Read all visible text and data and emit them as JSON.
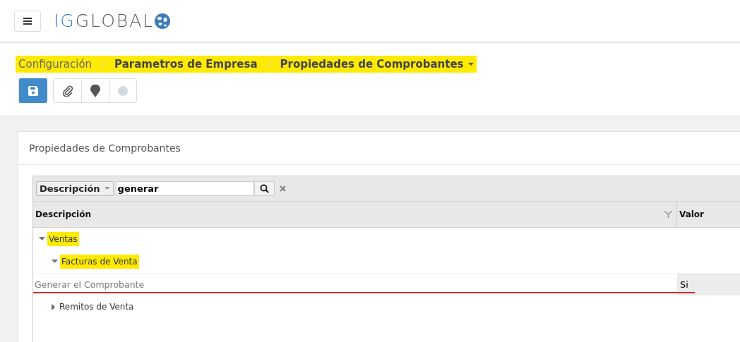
{
  "header": {
    "logo": {
      "prefix": "IG",
      "name": "GLOBAL"
    }
  },
  "breadcrumb": [
    {
      "label": "Configuración",
      "current": false,
      "highlighted": true
    },
    {
      "label": "Parametros de Empresa",
      "current": true,
      "highlighted": true
    },
    {
      "label": "Propiedades de Comprobantes",
      "current": true,
      "highlighted": true,
      "dropdown": true
    }
  ],
  "toolbar": [
    {
      "kind": "save",
      "primary": true
    },
    {
      "kind": "attach",
      "primary": false
    },
    {
      "kind": "pin",
      "primary": false
    },
    {
      "kind": "dot",
      "primary": false
    }
  ],
  "panel": {
    "title": "Propiedades de Comprobantes",
    "filter": {
      "field": "Descripción",
      "value": "generar"
    },
    "columns": [
      {
        "label": "Descripción",
        "filter": true
      },
      {
        "label": "Valor",
        "filter": false
      }
    ],
    "rows": [
      {
        "kind": "group",
        "label": "Ventas",
        "expanded": true,
        "highlighted": true,
        "children": [
          {
            "kind": "group",
            "label": "Facturas de Venta",
            "expanded": true,
            "highlighted": true,
            "children": [
              {
                "kind": "item",
                "label": "Generar el Comprobante",
                "value": "Si",
                "underlined": true
              }
            ]
          },
          {
            "kind": "group",
            "label": "Remitos de Venta",
            "expanded": false,
            "highlighted": false
          }
        ]
      }
    ]
  }
}
